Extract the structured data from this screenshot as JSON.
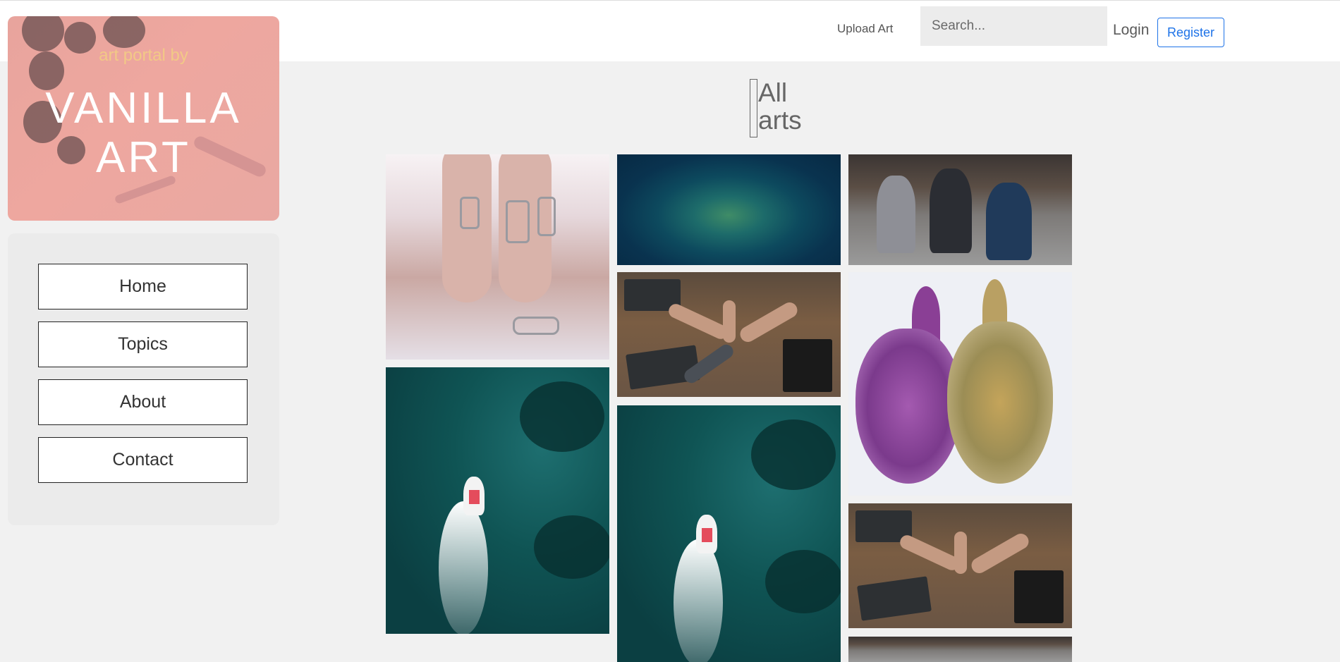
{
  "header": {
    "upload_label": "Upload Art",
    "search_placeholder": "Search...",
    "login_label": "Login",
    "register_label": "Register",
    "accent_color": "#1e73e8"
  },
  "brand": {
    "subtitle": "art portal by",
    "title": "VANILLA ART"
  },
  "sidebar": {
    "items": [
      {
        "label": "Home"
      },
      {
        "label": "Topics"
      },
      {
        "label": "About"
      },
      {
        "label": "Contact"
      }
    ]
  },
  "main": {
    "heading": "All arts",
    "gallery": [
      {
        "subject": "hands-with-rings"
      },
      {
        "subject": "aerial-island"
      },
      {
        "subject": "students-on-steps"
      },
      {
        "subject": "team-fist-bump-desk"
      },
      {
        "subject": "donkey-watercolor"
      },
      {
        "subject": "speedboat-aerial"
      },
      {
        "subject": "speedboat-aerial"
      },
      {
        "subject": "team-fist-bump-desk"
      },
      {
        "subject": "students-on-steps"
      }
    ]
  }
}
